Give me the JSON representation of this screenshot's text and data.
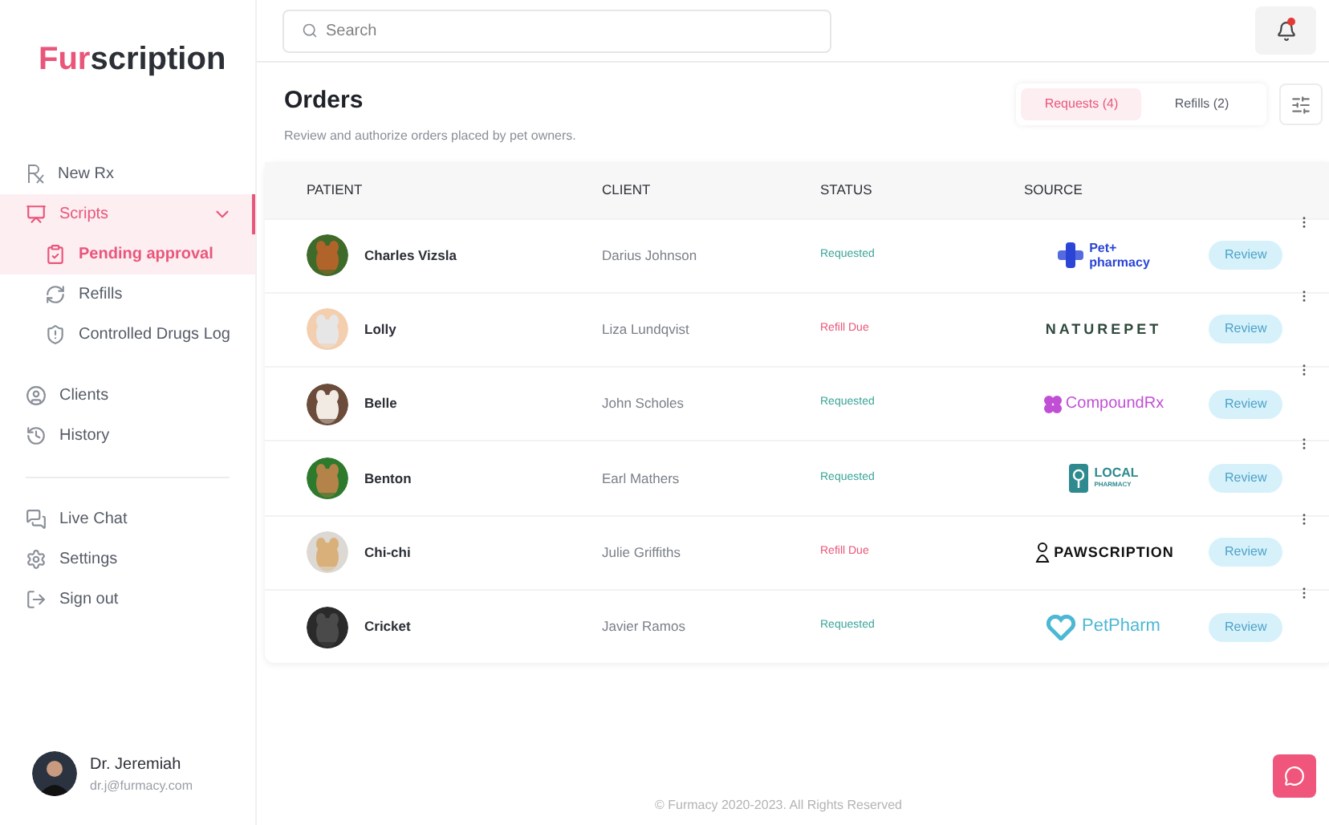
{
  "logo": {
    "accent": "Fur",
    "rest": "scription"
  },
  "nav": [
    {
      "label": "New Rx",
      "selected": false
    },
    {
      "label": "Scripts",
      "selected": true,
      "expanded": true,
      "children": [
        {
          "label": "Pending approval",
          "selected": true
        },
        {
          "label": "Refills",
          "selected": false
        },
        {
          "label": "Controlled Drugs Log",
          "selected": false
        }
      ]
    },
    {
      "label": "Clients",
      "selected": false
    },
    {
      "label": "History",
      "selected": false
    }
  ],
  "nav_bottom": [
    {
      "label": "Live Chat",
      "selected": false
    },
    {
      "label": "Settings",
      "selected": false
    },
    {
      "label": "Sign out",
      "selected": false
    }
  ],
  "user": {
    "name": "Dr. Jeremiah",
    "email": "dr.j@furmacy.com"
  },
  "search": {
    "placeholder": "Search"
  },
  "notifications": {
    "unread": true
  },
  "page": {
    "title": "Orders",
    "subtitle": "Review and authorize orders placed by pet owners."
  },
  "tabs": [
    {
      "label": "Requests (4)",
      "selected": true
    },
    {
      "label": "Refills (2)",
      "selected": false
    }
  ],
  "table": {
    "columns": [
      "PATIENT",
      "CLIENT",
      "STATUS",
      "SOURCE"
    ],
    "rows": [
      {
        "patient": "Charles Vizsla",
        "client": "Darius Johnson",
        "status": {
          "kind": "requested",
          "label": "Requested"
        },
        "source": {
          "kind": "plus",
          "lines": [
            "Pet+",
            "pharmacy"
          ]
        },
        "action": "Review"
      },
      {
        "patient": "Lolly",
        "client": "Liza Lundqvist",
        "status": {
          "kind": "refill_due",
          "label": "Refill Due"
        },
        "source": {
          "kind": "wordmark",
          "lines": [
            "NATUREPET"
          ]
        },
        "action": "Review"
      },
      {
        "patient": "Belle",
        "client": "John Scholes",
        "status": {
          "kind": "requested",
          "label": "Requested"
        },
        "source": {
          "kind": "flower",
          "lines": [
            "CompoundRx"
          ]
        },
        "action": "Review"
      },
      {
        "patient": "Benton",
        "client": "Earl Mathers",
        "status": {
          "kind": "requested",
          "label": "Requested"
        },
        "source": {
          "kind": "local",
          "lines": [
            "LOCAL",
            "PHARMACY"
          ]
        },
        "action": "Review"
      },
      {
        "patient": "Chi-chi",
        "client": "Julie Griffiths",
        "status": {
          "kind": "refill_due",
          "label": "Refill Due"
        },
        "source": {
          "kind": "paw",
          "lines": [
            "PAWSCRIPTION"
          ]
        },
        "action": "Review"
      },
      {
        "patient": "Cricket",
        "client": "Javier Ramos",
        "status": {
          "kind": "requested",
          "label": "Requested"
        },
        "source": {
          "kind": "heart",
          "lines": [
            "PetPharm"
          ]
        },
        "action": "Review"
      }
    ]
  },
  "footer": "© Furmacy 2020-2023. All Rights Reserved"
}
